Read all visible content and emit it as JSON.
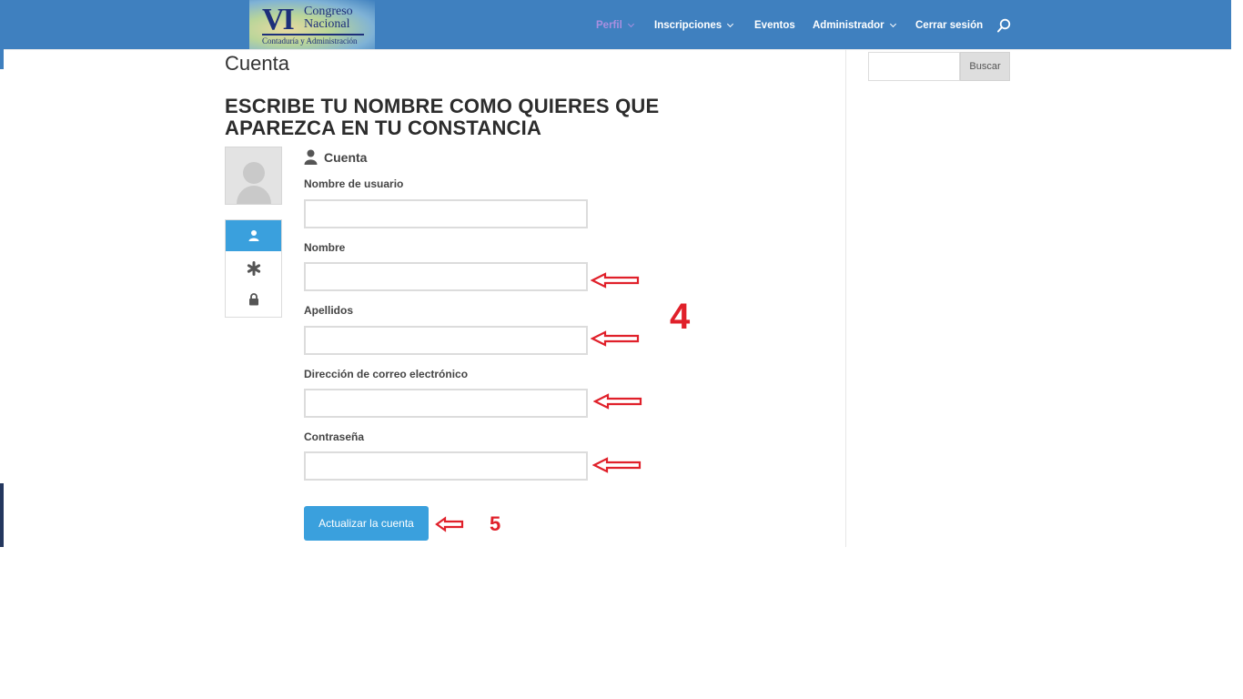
{
  "site": {
    "logo": {
      "numeral": "VI",
      "line1": "Congreso",
      "line2": "Nacional",
      "line3": "Contaduría y Administración"
    },
    "nav": [
      {
        "label": "Perfil",
        "active": true,
        "has_dropdown": true
      },
      {
        "label": "Inscripciones",
        "has_dropdown": true
      },
      {
        "label": "Eventos",
        "has_dropdown": false
      },
      {
        "label": "Administrador",
        "has_dropdown": true
      },
      {
        "label": "Cerrar sesión",
        "has_dropdown": false
      }
    ],
    "header_color": "#3f80bf",
    "active_nav_color": "#a98fe0"
  },
  "page": {
    "title": "Cuenta",
    "heading": "ESCRIBE TU NOMBRE COMO QUIERES QUE APAREZCA EN TU CONSTANCIA"
  },
  "account": {
    "section_title": "Cuenta",
    "tabs": [
      {
        "icon": "user-icon",
        "active": true
      },
      {
        "icon": "asterisk-icon",
        "active": false
      },
      {
        "icon": "lock-icon",
        "active": false
      }
    ],
    "fields": {
      "username": {
        "label": "Nombre de usuario",
        "value": ""
      },
      "first_name": {
        "label": "Nombre",
        "value": ""
      },
      "last_name": {
        "label": "Apellidos",
        "value": ""
      },
      "email": {
        "label": "Dirección de correo electrónico",
        "value": ""
      },
      "password": {
        "label": "Contraseña",
        "value": ""
      }
    },
    "submit_label": "Actualizar la cuenta",
    "button_color": "#3aa0dd"
  },
  "annotations": {
    "step_fields": "4",
    "step_button": "5",
    "color": "#e0202a"
  },
  "sidebar": {
    "search_placeholder": "",
    "search_button": "Buscar"
  }
}
